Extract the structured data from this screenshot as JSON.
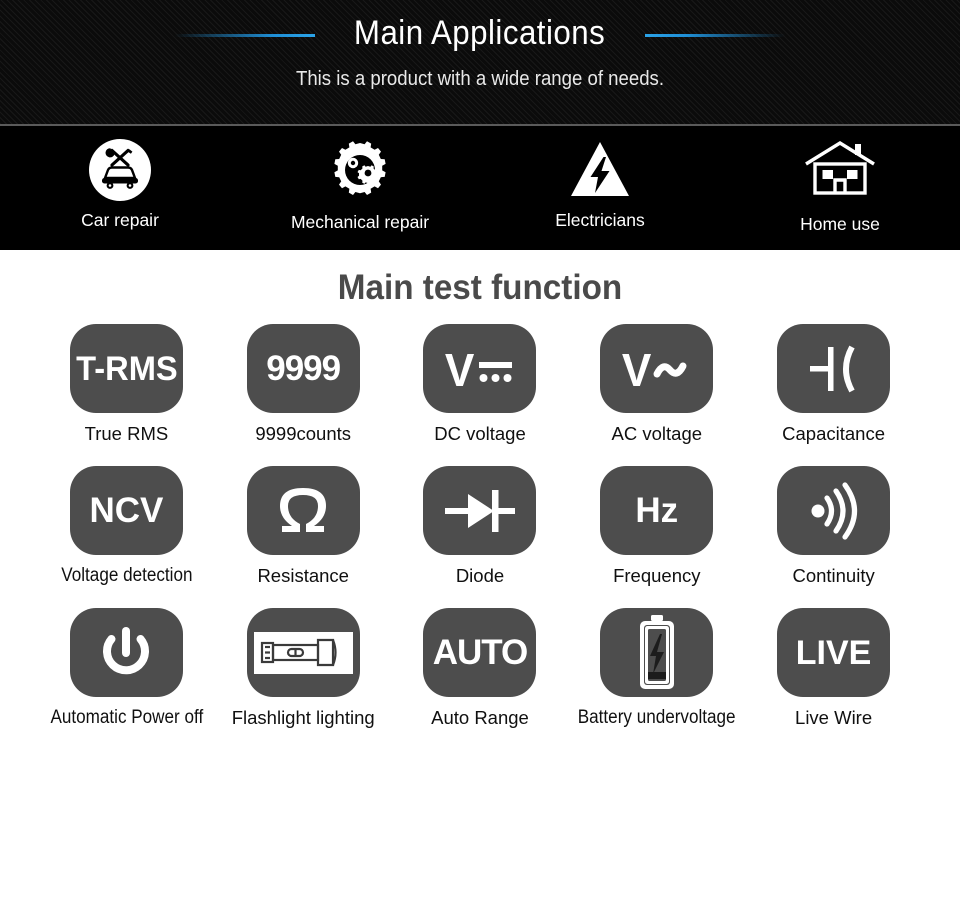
{
  "header": {
    "title": "Main Applications",
    "subtitle": "This is a product with a wide range of needs.",
    "accent_color": "#1f8fd6",
    "background_color": "#0b0b0b"
  },
  "applications": [
    {
      "label": "Car repair",
      "icon": "car-repair-icon"
    },
    {
      "label": "Mechanical repair",
      "icon": "gear-icon"
    },
    {
      "label": "Electricians",
      "icon": "high-voltage-triangle-icon"
    },
    {
      "label": "Home use",
      "icon": "house-icon"
    }
  ],
  "functions_section": {
    "title": "Main test function",
    "tile_color": "#4d4d4d",
    "rows": [
      [
        {
          "icon": "t-rms-text-icon",
          "glyph": "T-RMS",
          "label": "True RMS"
        },
        {
          "icon": "counts-text-icon",
          "glyph": "9999",
          "label": "9999counts"
        },
        {
          "icon": "dc-voltage-icon",
          "glyph": "V⎓",
          "label": "DC voltage"
        },
        {
          "icon": "ac-voltage-icon",
          "glyph": "V~",
          "label": "AC voltage"
        },
        {
          "icon": "capacitor-icon",
          "glyph": "",
          "label": "Capacitance"
        }
      ],
      [
        {
          "icon": "ncv-text-icon",
          "glyph": "NCV",
          "label": "Voltage detection"
        },
        {
          "icon": "ohm-icon",
          "glyph": "Ω",
          "label": "Resistance"
        },
        {
          "icon": "diode-icon",
          "glyph": "",
          "label": "Diode"
        },
        {
          "icon": "hertz-text-icon",
          "glyph": "Hz",
          "label": "Frequency"
        },
        {
          "icon": "continuity-buzzer-icon",
          "glyph": "",
          "label": "Continuity"
        }
      ],
      [
        {
          "icon": "power-icon",
          "glyph": "",
          "label": "Automatic Power off"
        },
        {
          "icon": "flashlight-icon",
          "glyph": "",
          "label": "Flashlight lighting"
        },
        {
          "icon": "auto-text-icon",
          "glyph": "AUTO",
          "label": "Auto Range"
        },
        {
          "icon": "battery-low-icon",
          "glyph": "",
          "label": "Battery undervoltage"
        },
        {
          "icon": "live-text-icon",
          "glyph": "LIVE",
          "label": "Live Wire"
        }
      ]
    ]
  }
}
